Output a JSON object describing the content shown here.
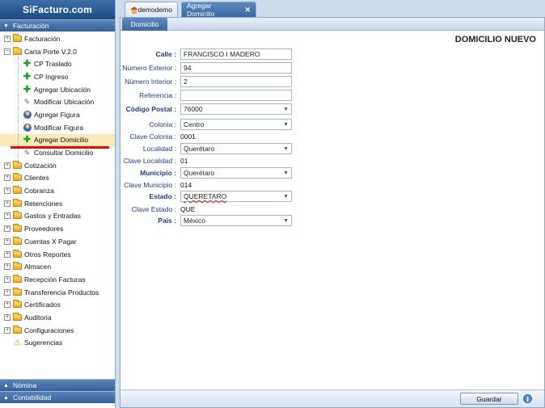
{
  "app": {
    "brand": "SiFacturo.com"
  },
  "sidebar": {
    "top_section": "Facturación",
    "tree": [
      {
        "label": "Facturación",
        "toggle": "+",
        "icon": "folder-icon"
      },
      {
        "label": "Carta Porte V.2.0",
        "toggle": "−",
        "icon": "folder-open-icon"
      },
      {
        "label": "CP Traslado",
        "child": true,
        "icon": "plus-icon"
      },
      {
        "label": "CP Ingreso",
        "child": true,
        "icon": "plus-icon"
      },
      {
        "label": "Agregar Ubicación",
        "child": true,
        "icon": "plus-icon"
      },
      {
        "label": "Modificar Ubicación",
        "child": true,
        "icon": "pencil-icon"
      },
      {
        "label": "Agregar Figura",
        "child": true,
        "icon": "person-icon"
      },
      {
        "label": "Modificar Figura",
        "child": true,
        "icon": "person-icon"
      },
      {
        "label": "Agregar Domicilio",
        "child": true,
        "icon": "plus-icon",
        "selected": true
      },
      {
        "label": "Consultar Domicilio",
        "child": true,
        "icon": "pencil-icon"
      },
      {
        "label": "Cotización",
        "toggle": "+",
        "icon": "folder-icon"
      },
      {
        "label": "Clientes",
        "toggle": "+",
        "icon": "folder-icon"
      },
      {
        "label": "Cobranza",
        "toggle": "+",
        "icon": "folder-icon"
      },
      {
        "label": "Retenciones",
        "toggle": "+",
        "icon": "folder-icon"
      },
      {
        "label": "Gastos y Entradas",
        "toggle": "+",
        "icon": "folder-icon"
      },
      {
        "label": "Proveedores",
        "toggle": "+",
        "icon": "folder-icon"
      },
      {
        "label": "Cuentas X Pagar",
        "toggle": "+",
        "icon": "folder-icon"
      },
      {
        "label": "Otros Reportes",
        "toggle": "+",
        "icon": "folder-icon"
      },
      {
        "label": "Almacen",
        "toggle": "+",
        "icon": "folder-icon"
      },
      {
        "label": "Recepción Facturas",
        "toggle": "+",
        "icon": "folder-icon"
      },
      {
        "label": "Transferencia Productos",
        "toggle": "+",
        "icon": "folder-icon"
      },
      {
        "label": "Certificados",
        "toggle": "+",
        "icon": "folder-icon"
      },
      {
        "label": "Auditoria",
        "toggle": "+",
        "icon": "folder-icon"
      },
      {
        "label": "Configuraciones",
        "toggle": "+",
        "icon": "folder-icon"
      },
      {
        "label": "Sugerencias",
        "toggle": "",
        "icon": "warning-icon"
      }
    ],
    "bottom_sections": [
      "Nómina",
      "Contabilidad"
    ]
  },
  "tabs": [
    {
      "label": "demodemo",
      "icon": "home-icon"
    },
    {
      "label": "Agregar Domicilio",
      "closable": true
    }
  ],
  "subtab": "Domicilio",
  "form": {
    "title": "DOMICILIO NUEVO",
    "calle_label": "Calle",
    "calle_value": "FRANCISCO I MADERO",
    "num_ext_label": "Número Exterior",
    "num_ext_value": "94",
    "num_int_label": "Número Interior",
    "num_int_value": "2",
    "referencia_label": "Referencia",
    "referencia_value": "",
    "cp_label": "Código Postal",
    "cp_value": "76000",
    "colonia_label": "Colonia",
    "colonia_value": "Centro",
    "clave_colonia_label": "Clave Colonia",
    "clave_colonia_value": "0001",
    "localidad_label": "Localidad",
    "localidad_value": "Querétaro",
    "clave_localidad_label": "Clave Localidad",
    "clave_localidad_value": "01",
    "municipio_label": "Municipio",
    "municipio_value": "Querétaro",
    "clave_municipio_label": "Clave Municipio",
    "clave_municipio_value": "014",
    "estado_label": "Estado",
    "estado_value": "QUERETARO",
    "clave_estado_label": "Clave Estado",
    "clave_estado_value": "QUE",
    "pais_label": "Pais",
    "pais_value": "México"
  },
  "footer": {
    "save_label": "Guardar",
    "info_glyph": "i"
  }
}
